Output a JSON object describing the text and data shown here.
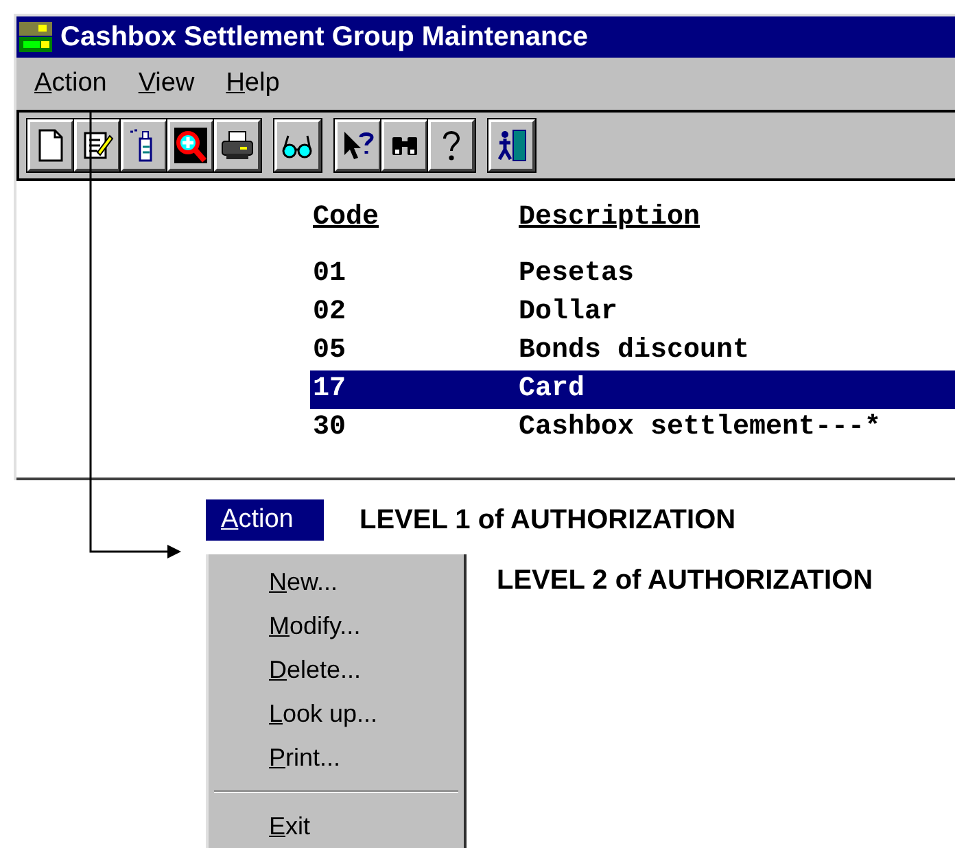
{
  "window": {
    "title": "Cashbox Settlement Group Maintenance"
  },
  "menu_bar": [
    "Action",
    "View",
    "Help"
  ],
  "toolbar": [
    [
      {
        "kind": "new"
      },
      {
        "kind": "modify"
      },
      {
        "kind": "delete"
      },
      {
        "kind": "zoom"
      },
      {
        "kind": "print"
      }
    ],
    [
      {
        "kind": "glasses"
      }
    ],
    [
      {
        "kind": "helppointer"
      },
      {
        "kind": "binoculars"
      },
      {
        "kind": "question"
      }
    ],
    [
      {
        "kind": "exit"
      }
    ]
  ],
  "list": {
    "columns": [
      "Code",
      "Description"
    ],
    "rows": [
      {
        "code": "01",
        "description": "Pesetas",
        "selected": false
      },
      {
        "code": "02",
        "description": "Dollar",
        "selected": false
      },
      {
        "code": "05",
        "description": "Bonds discount",
        "selected": false
      },
      {
        "code": "17",
        "description": "Card",
        "selected": true
      },
      {
        "code": "30",
        "description": "Cashbox settlement---*",
        "selected": false
      }
    ]
  },
  "action_menu": {
    "title": "Action",
    "note": "LEVEL 1 of AUTHORIZATION",
    "items_note": "LEVEL 2 of AUTHORIZATION",
    "items": [
      {
        "kind": "item",
        "label": "New..."
      },
      {
        "kind": "item",
        "label": "Modify..."
      },
      {
        "kind": "item",
        "label": "Delete..."
      },
      {
        "kind": "item",
        "label": "Look up..."
      },
      {
        "kind": "item",
        "label": "Print..."
      },
      {
        "kind": "separator"
      },
      {
        "kind": "item",
        "label": "Exit"
      }
    ]
  }
}
